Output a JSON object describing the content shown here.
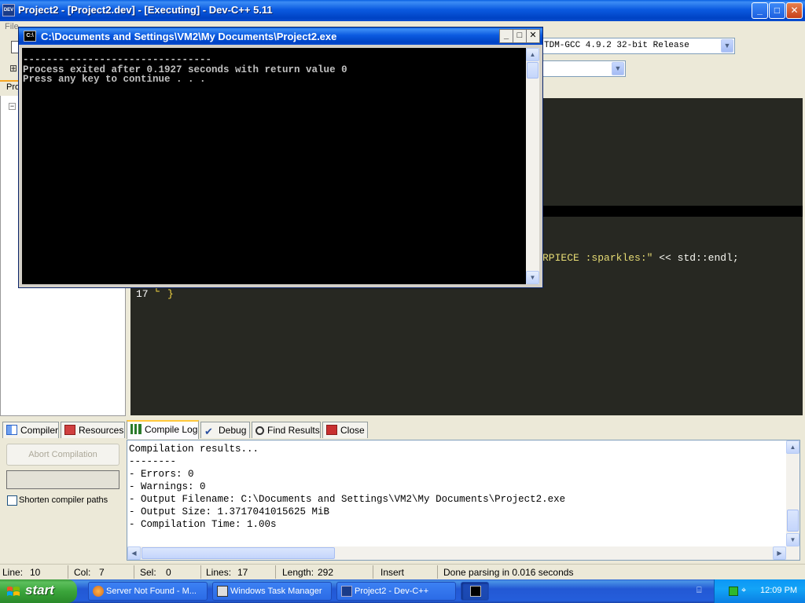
{
  "main_window": {
    "title": "Project2 - [Project2.dev] - [Executing] - Dev-C++ 5.11",
    "app_icon_text": "DEV",
    "caption": {
      "minimize": "_",
      "maximize": "□",
      "close": "✕"
    }
  },
  "menu": {
    "file_label": "File"
  },
  "toolbar": {
    "compiler_select_value": "TDM-GCC 4.9.2 32-bit Release",
    "second_select_value": ""
  },
  "project_panel": {
    "tab_label": "Pro",
    "expander": "−"
  },
  "editor": {
    "visible_code_fragment": {
      "string_part": "RPIECE :sparkles:\"",
      "operator": " << ",
      "identifier": "std::endl;"
    },
    "line_17": {
      "number": "17",
      "guide": "└",
      "brace": "}"
    }
  },
  "bottom_tabs": [
    {
      "label": "Compiler",
      "icon": "compiler-icon",
      "active": false
    },
    {
      "label": "Resources",
      "icon": "resources-icon",
      "active": false
    },
    {
      "label": "Compile Log",
      "icon": "compile-log-icon",
      "active": true
    },
    {
      "label": "Debug",
      "icon": "debug-icon",
      "active": false
    },
    {
      "label": "Find Results",
      "icon": "find-results-icon",
      "active": false
    },
    {
      "label": "Close",
      "icon": "close-tab-icon",
      "active": false
    }
  ],
  "compile_options": {
    "abort_label": "Abort Compilation",
    "shorten_paths_label": "Shorten compiler paths",
    "shorten_paths_checked": false
  },
  "compile_log": {
    "lines": [
      "Compilation results...",
      "--------",
      "- Errors: 0",
      "- Warnings: 0",
      "- Output Filename: C:\\Documents and Settings\\VM2\\My Documents\\Project2.exe",
      "- Output Size: 1.3717041015625 MiB",
      "- Compilation Time: 1.00s"
    ]
  },
  "statusbar": {
    "line_label": "Line:",
    "line_value": "10",
    "col_label": "Col:",
    "col_value": "7",
    "sel_label": "Sel:",
    "sel_value": "0",
    "lines_label": "Lines:",
    "lines_value": "17",
    "length_label": "Length:",
    "length_value": "292",
    "mode": "Insert",
    "message": "Done parsing in 0.016 seconds"
  },
  "console_window": {
    "title": "C:\\Documents and Settings\\VM2\\My Documents\\Project2.exe",
    "icon_text": "C:\\",
    "lines": [
      "--------------------------------",
      "Process exited after 0.1927 seconds with return value 0",
      "Press any key to continue . . ."
    ]
  },
  "taskbar": {
    "start_label": "start",
    "tasks": [
      {
        "label": "Server Not Found - M...",
        "active": false
      },
      {
        "label": "Windows Task Manager",
        "active": false
      },
      {
        "label": "Project2 - Dev-C++",
        "active": false
      },
      {
        "label": "",
        "active": true
      }
    ],
    "clock": "12:09 PM"
  },
  "colors": {
    "editor_bg": "#272822",
    "string": "#e6db74",
    "console_bg": "#000000",
    "xp_blue": "#0a5fe2",
    "start_green": "#3ba53b"
  }
}
